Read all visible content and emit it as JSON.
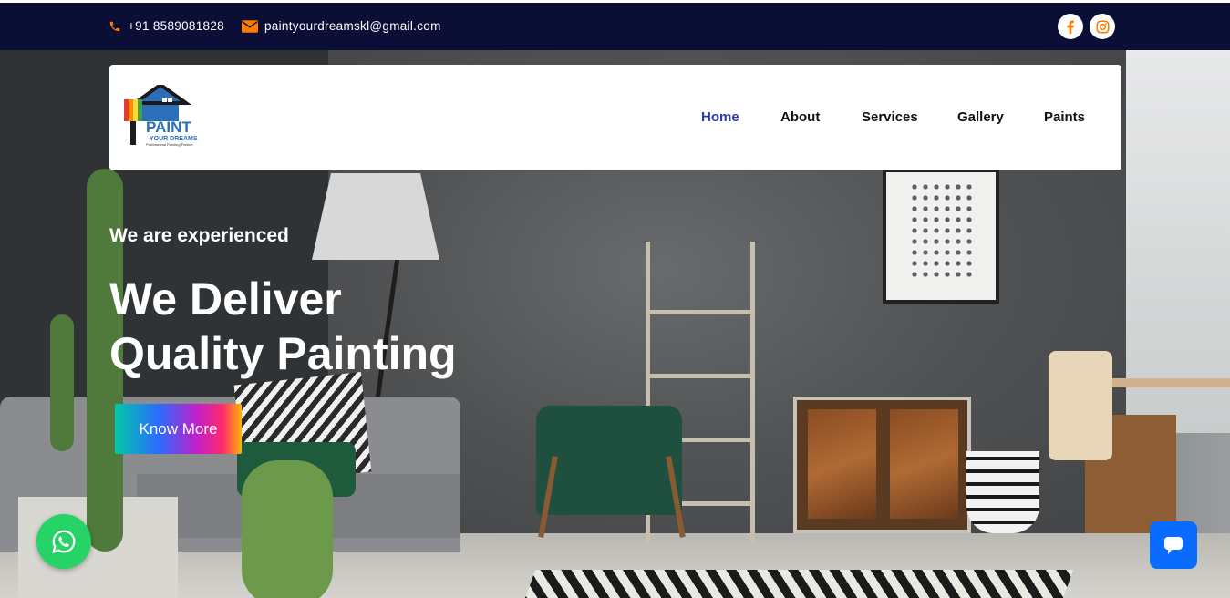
{
  "topbar": {
    "phone": "+91 8589081828",
    "email": "paintyourdreamskl@gmail.com",
    "social": [
      {
        "icon": "facebook-icon"
      },
      {
        "icon": "instagram-icon"
      }
    ]
  },
  "brand": {
    "logo_text": "PAINT",
    "logo_sub": "YOUR DREAMS",
    "logo_tagline": "Professional Painting Partner"
  },
  "nav": {
    "items": [
      {
        "label": "Home",
        "active": true
      },
      {
        "label": "About",
        "active": false
      },
      {
        "label": "Services",
        "active": false
      },
      {
        "label": "Gallery",
        "active": false
      },
      {
        "label": "Paints",
        "active": false
      }
    ]
  },
  "hero": {
    "kicker": "We are experienced",
    "headline_line1": "We Deliver",
    "headline_line2": "Quality Painting",
    "cta_label": "Know More"
  },
  "widgets": {
    "whatsapp_icon": "whatsapp-icon",
    "chat_icon": "chat-icon"
  },
  "colors": {
    "topbar_bg": "#0b0f35",
    "accent_orange": "#ff7a00",
    "nav_active": "#2e3aa3",
    "whatsapp_green": "#25d366",
    "chat_blue": "#0a6cff"
  }
}
